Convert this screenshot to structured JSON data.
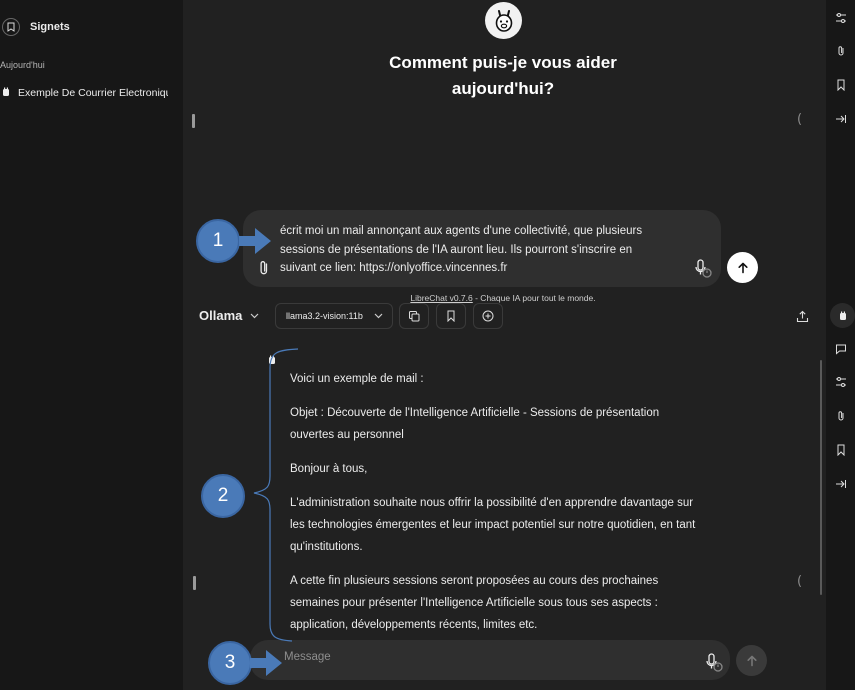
{
  "sidebar": {
    "title": "Signets",
    "section": "Aujourd'hui",
    "conversation": "Exemple De Courrier Electronique"
  },
  "welcome": {
    "heading_line1": "Comment puis-je vous aider",
    "heading_line2": "aujourd'hui?"
  },
  "composer_top": {
    "line1": "écrit moi un mail annonçant aux agents d'une collectivité, que plusieurs",
    "line2": "sessions de présentations de l'IA auront lieu. Ils pourront s'inscrire en",
    "line3": "suivant ce lien:  https://onlyoffice.vincennes.fr"
  },
  "footer": {
    "link": "LibreChat v0.7.6",
    "tagline": " - Chaque IA pour tout le monde."
  },
  "toolbar": {
    "endpoint": "Ollama",
    "model": "llama3.2-vision:11b"
  },
  "message": {
    "p1": "Voici un exemple de mail :",
    "p2_line1": "Objet : Découverte de l'Intelligence Artificielle - Sessions de présentation",
    "p2_line2": "ouvertes au personnel",
    "p3": "Bonjour à tous,",
    "p4_line1": "L'administration souhaite nous offrir la possibilité d'en apprendre davantage sur",
    "p4_line2": "les technologies émergentes et leur impact potentiel sur notre quotidien, en tant",
    "p4_line3": "qu'institutions.",
    "p5_line1": "A cette fin plusieurs sessions seront proposées au cours des prochaines",
    "p5_line2": "semaines pour présenter l'Intelligence Artificielle sous tous ses aspects :",
    "p5_line3": "application, développements récents, limites etc."
  },
  "composer_bottom": {
    "placeholder": "Message"
  },
  "annotations": {
    "badge1": "1",
    "badge2": "2",
    "badge3": "3"
  },
  "colors": {
    "background": "#212121",
    "sidebar": "#171717",
    "composer": "#2f2f2f",
    "annotation": "#4a7ab8"
  }
}
